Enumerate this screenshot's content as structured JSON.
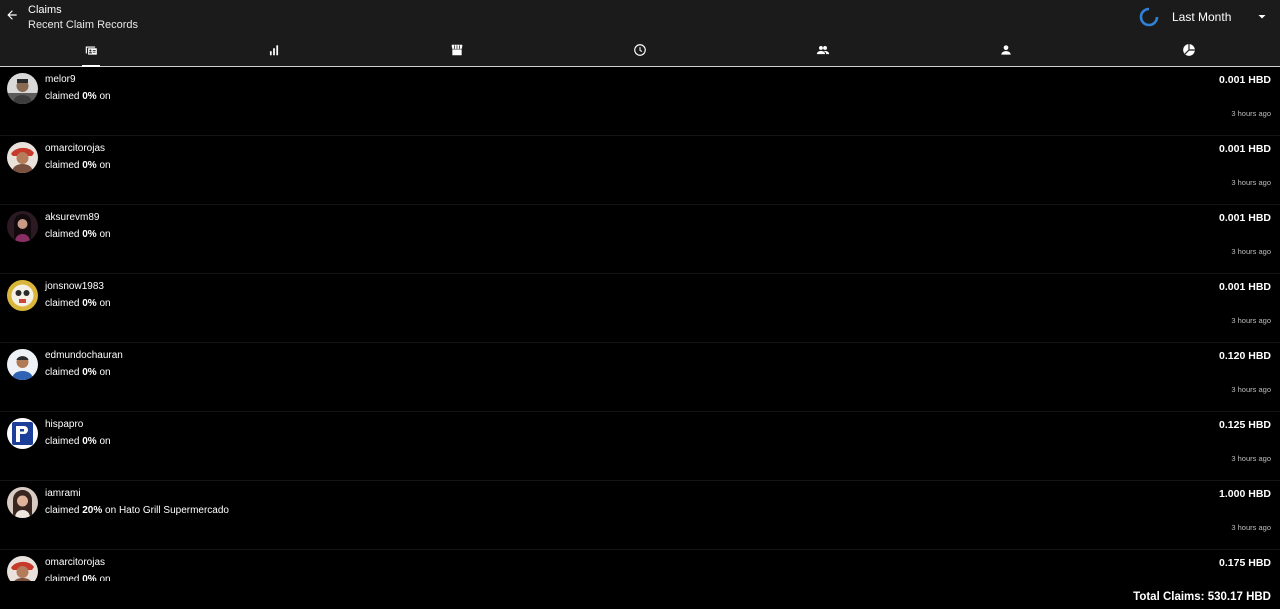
{
  "header": {
    "title": "Claims",
    "subtitle": "Recent Claim Records",
    "range_label": "Last Month"
  },
  "tabs": [
    {
      "icon": "card-icon",
      "active": true
    },
    {
      "icon": "bar-chart-icon",
      "active": false
    },
    {
      "icon": "store-icon",
      "active": false
    },
    {
      "icon": "clock-icon",
      "active": false
    },
    {
      "icon": "group-icon",
      "active": false
    },
    {
      "icon": "person-icon",
      "active": false
    },
    {
      "icon": "pie-chart-icon",
      "active": false
    }
  ],
  "claims": [
    {
      "user": "melor9",
      "prefix": "claimed ",
      "percent": "0%",
      "suffix": " on",
      "amount": "0.001 HBD",
      "time": "3 hours ago"
    },
    {
      "user": "omarcitorojas",
      "prefix": "claimed ",
      "percent": "0%",
      "suffix": " on",
      "amount": "0.001 HBD",
      "time": "3 hours ago"
    },
    {
      "user": "aksurevm89",
      "prefix": "claimed ",
      "percent": "0%",
      "suffix": " on",
      "amount": "0.001 HBD",
      "time": "3 hours ago"
    },
    {
      "user": "jonsnow1983",
      "prefix": "claimed ",
      "percent": "0%",
      "suffix": " on",
      "amount": "0.001 HBD",
      "time": "3 hours ago"
    },
    {
      "user": "edmundochauran",
      "prefix": "claimed ",
      "percent": "0%",
      "suffix": " on",
      "amount": "0.120 HBD",
      "time": "3 hours ago"
    },
    {
      "user": "hispapro",
      "prefix": "claimed ",
      "percent": "0%",
      "suffix": " on",
      "amount": "0.125 HBD",
      "time": "3 hours ago"
    },
    {
      "user": "iamrami",
      "prefix": "claimed ",
      "percent": "20%",
      "suffix": " on Hato Grill Supermercado",
      "amount": "1.000 HBD",
      "time": "3 hours ago"
    },
    {
      "user": "omarcitorojas",
      "prefix": "claimed ",
      "percent": "0%",
      "suffix": " on",
      "amount": "0.175 HBD",
      "time": ""
    }
  ],
  "footer": {
    "total": "Total Claims: 530.17 HBD"
  },
  "colors": {
    "background": "#000000",
    "header_bg": "#1b1b1b",
    "spinner": "#2f80d6",
    "text": "#ffffff",
    "muted": "#bdbdbd"
  }
}
